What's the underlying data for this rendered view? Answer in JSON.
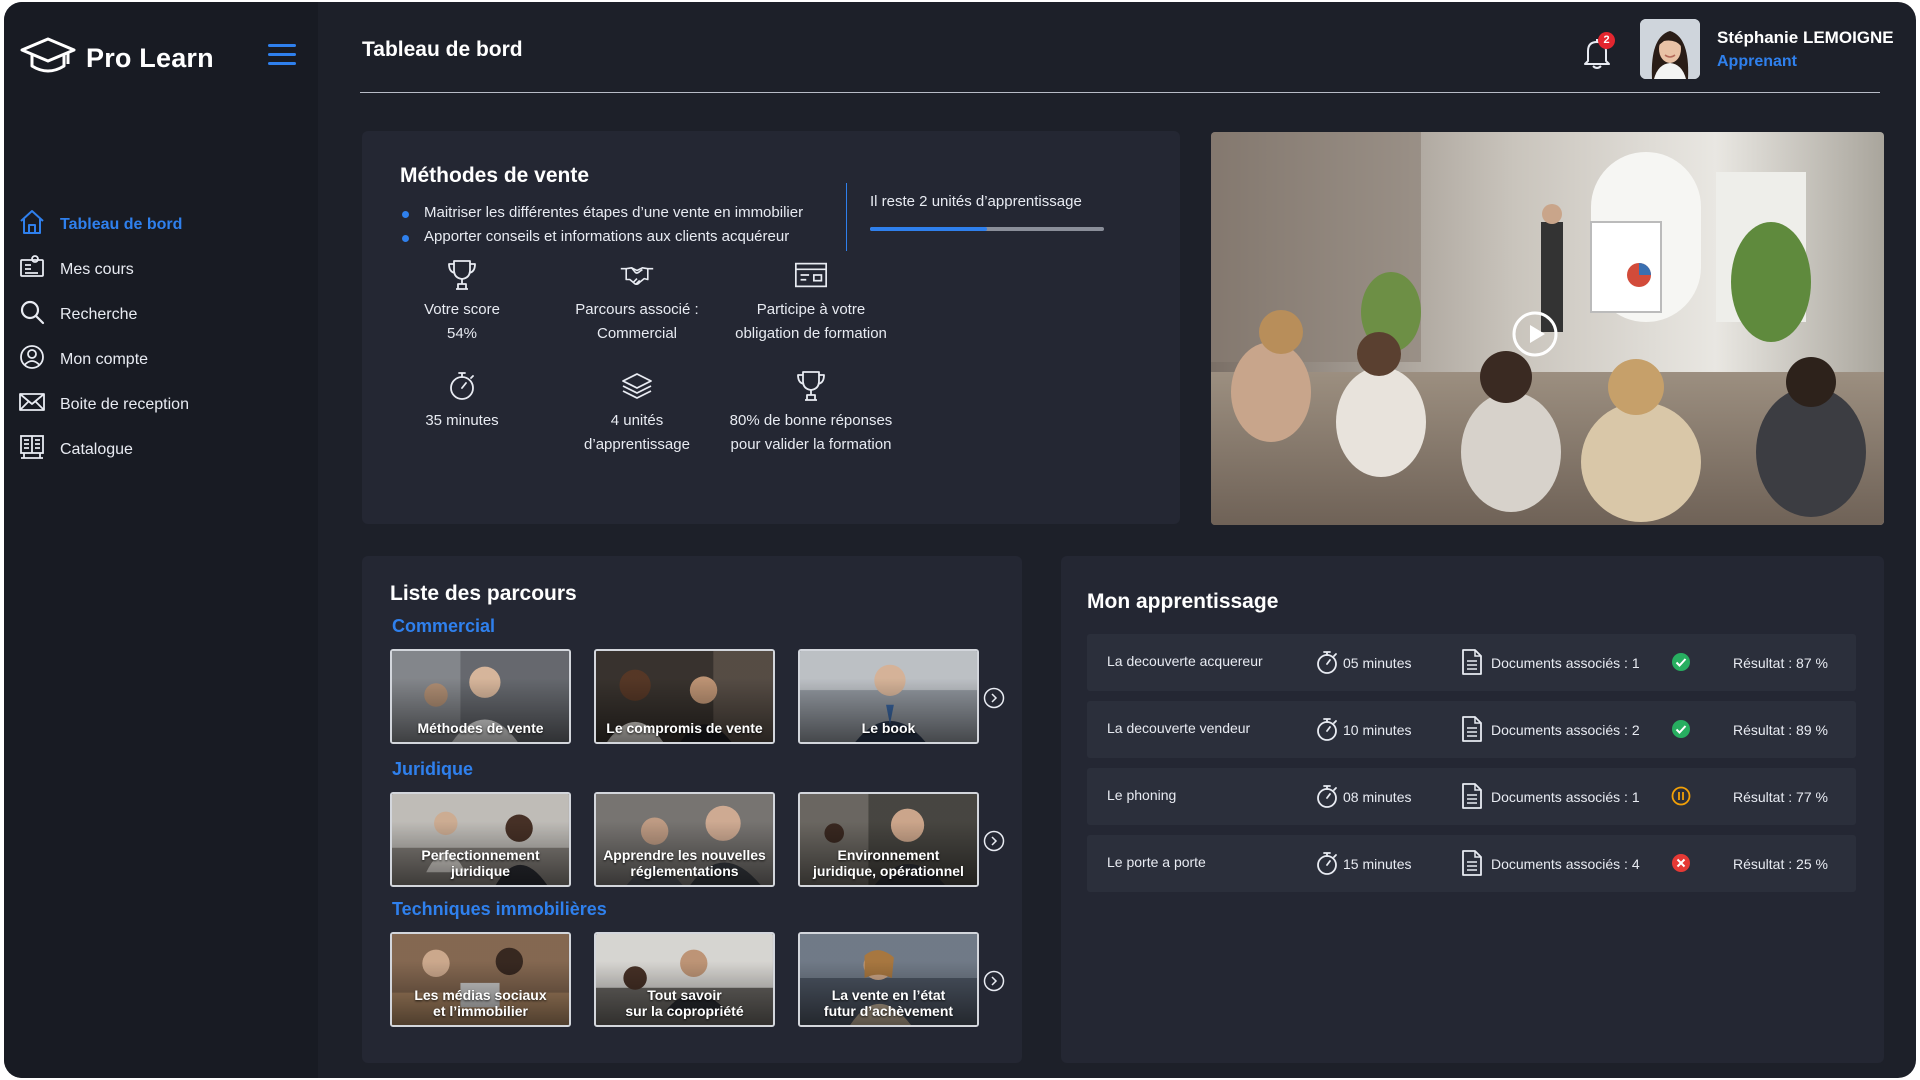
{
  "app": {
    "name": "Pro Learn",
    "logo_icon": "graduation-cap-icon",
    "menu_icon": "hamburger-menu-icon",
    "accent_color": "#2f80ed"
  },
  "sidebar": {
    "items": [
      {
        "label": "Tableau de bord",
        "icon": "home-icon",
        "active": true
      },
      {
        "label": "Mes cours",
        "icon": "courses-icon",
        "active": false
      },
      {
        "label": "Recherche",
        "icon": "search-icon",
        "active": false
      },
      {
        "label": "Mon compte",
        "icon": "account-icon",
        "active": false
      },
      {
        "label": "Boite de reception",
        "icon": "mail-icon",
        "active": false
      },
      {
        "label": "Catalogue",
        "icon": "catalog-icon",
        "active": false
      }
    ]
  },
  "header": {
    "title": "Tableau de bord",
    "notifications_count": "2",
    "user_name": "Stéphanie LEMOIGNE",
    "user_role": "Apprenant"
  },
  "course": {
    "title": "Méthodes de vente",
    "objectives": [
      "Maitriser les différentes étapes d’une vente en immobilier",
      "Apporter conseils et informations aux clients acquéreur"
    ],
    "remaining_text": "Il reste 2 unités d’apprentissage",
    "progress_fraction": 0.5,
    "stats": [
      {
        "icon": "trophy-icon",
        "line1": "Votre score",
        "line2": "54%"
      },
      {
        "icon": "handshake-icon",
        "line1": "Parcours associé :",
        "line2": "Commercial"
      },
      {
        "icon": "certificate-icon",
        "line1": "Participe à votre",
        "line2": "obligation de formation"
      },
      {
        "icon": "stopwatch-icon",
        "line1": "35 minutes",
        "line2": ""
      },
      {
        "icon": "layers-icon",
        "line1": "4 unités",
        "line2": "d’apprentissage"
      },
      {
        "icon": "trophy-icon",
        "line1": "80% de bonne réponses",
        "line2": "pour valider la formation"
      }
    ]
  },
  "video": {
    "play_icon": "play-icon"
  },
  "parcours": {
    "title": "Liste des parcours",
    "categories": [
      {
        "label": "Commercial",
        "items": [
          {
            "line1": "Méthodes de vente",
            "line2": ""
          },
          {
            "line1": "Le compromis de vente",
            "line2": ""
          },
          {
            "line1": "Le book",
            "line2": ""
          }
        ]
      },
      {
        "label": "Juridique",
        "items": [
          {
            "line1": "Perfectionnement",
            "line2": "juridique"
          },
          {
            "line1": "Apprendre les nouvelles",
            "line2": "réglementations"
          },
          {
            "line1": "Environnement",
            "line2": "juridique, opérationnel"
          }
        ]
      },
      {
        "label": "Techniques immobilières",
        "items": [
          {
            "line1": "Les médias sociaux",
            "line2": "et l’immobilier"
          },
          {
            "line1": "Tout savoir",
            "line2": "sur la copropriété"
          },
          {
            "line1": "La vente en l’état",
            "line2": "futur d’achèvement"
          }
        ]
      }
    ]
  },
  "learning": {
    "title": "Mon apprentissage",
    "rows": [
      {
        "name": "La decouverte acquereur",
        "duration": "05 minutes",
        "documents": "Documents associés : 1",
        "status": "success",
        "result": "Résultat : 87 %"
      },
      {
        "name": "La decouverte vendeur",
        "duration": "10 minutes",
        "documents": "Documents associés : 2",
        "status": "success",
        "result": "Résultat : 89 %"
      },
      {
        "name": "Le phoning",
        "duration": "08 minutes",
        "documents": "Documents associés : 1",
        "status": "paused",
        "result": "Résultat : 77 %"
      },
      {
        "name": "Le porte a porte",
        "duration": "15 minutes",
        "documents": "Documents associés : 4",
        "status": "failed",
        "result": "Résultat : 25 %"
      }
    ],
    "status_colors": {
      "success": "#27ae60",
      "paused": "#f2a007",
      "failed": "#e53935"
    }
  }
}
